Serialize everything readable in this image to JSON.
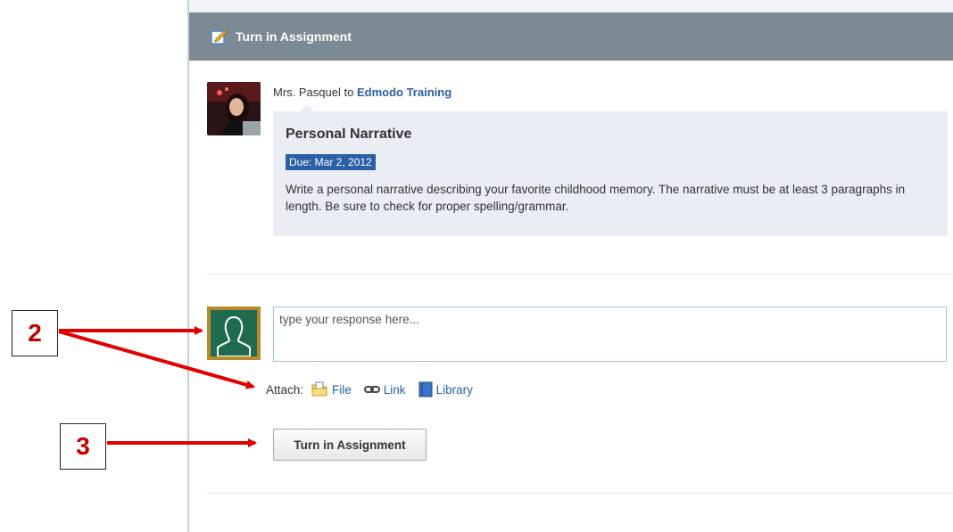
{
  "header": {
    "title": "Turn in Assignment",
    "icon": "pencil-note-icon",
    "background": "#7c8a93"
  },
  "post": {
    "author": "Mrs. Pasquel",
    "connector": "to",
    "group": "Edmodo Training",
    "assignment": {
      "title": "Personal Narrative",
      "due": "Due: Mar 2, 2012",
      "description": "Write a personal narrative describing your favorite childhood memory. The narrative must be at least 3 paragraphs in length. Be sure to check for proper spelling/grammar."
    }
  },
  "response": {
    "placeholder": "type your response here...",
    "value": "",
    "attach_label": "Attach:",
    "attach_options": [
      {
        "label": "File",
        "icon": "file-icon"
      },
      {
        "label": "Link",
        "icon": "link-icon"
      },
      {
        "label": "Library",
        "icon": "library-icon"
      }
    ],
    "submit_label": "Turn in Assignment"
  },
  "annotations": [
    {
      "label": "2"
    },
    {
      "label": "3"
    }
  ],
  "colors": {
    "link": "#2b5fa6",
    "card": "#eaeef4",
    "arrow": "#e00000"
  }
}
